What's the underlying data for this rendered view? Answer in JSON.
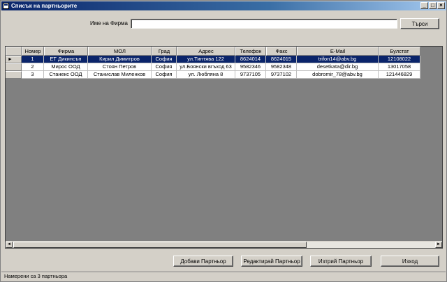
{
  "window": {
    "title": "Списък на партньорите",
    "buttons": [
      "_",
      "□",
      "×"
    ]
  },
  "search": {
    "label": "Име на Фирма",
    "value": "",
    "button": "Търси"
  },
  "grid": {
    "columns": [
      "Номер",
      "Фирма",
      "МОЛ",
      "Град",
      "Адрес",
      "Телефон",
      "Факс",
      "E-Mail",
      "Булстат"
    ],
    "rows": [
      [
        "1",
        "ЕТ Дикинсън",
        "Кирил Димитров",
        "София",
        "ул.Тинтява 122",
        "8624014",
        "8624015",
        "trifon14@abv.bg",
        "12108022"
      ],
      [
        "2",
        "Мирос ООД",
        "Стоян Петров",
        "София",
        "ул.Боянски вгъход 63",
        "9582346",
        "9582348",
        "desetkata@dir.bg",
        "13017058"
      ],
      [
        "3",
        "Станекс ООД",
        "Станислав Миленков",
        "София",
        "ул. Любляна 8",
        "9737105",
        "9737102",
        "dobromir_78@abv.bg",
        "121446829"
      ]
    ],
    "selected_row": 0,
    "current_row_marker": "►"
  },
  "actions": {
    "add": "Добави Партньор",
    "edit": "Редактирай Партньор",
    "delete": "Изтрий Партньор",
    "exit": "Изход"
  },
  "status": {
    "text": "Намерени са 3 партньора"
  }
}
